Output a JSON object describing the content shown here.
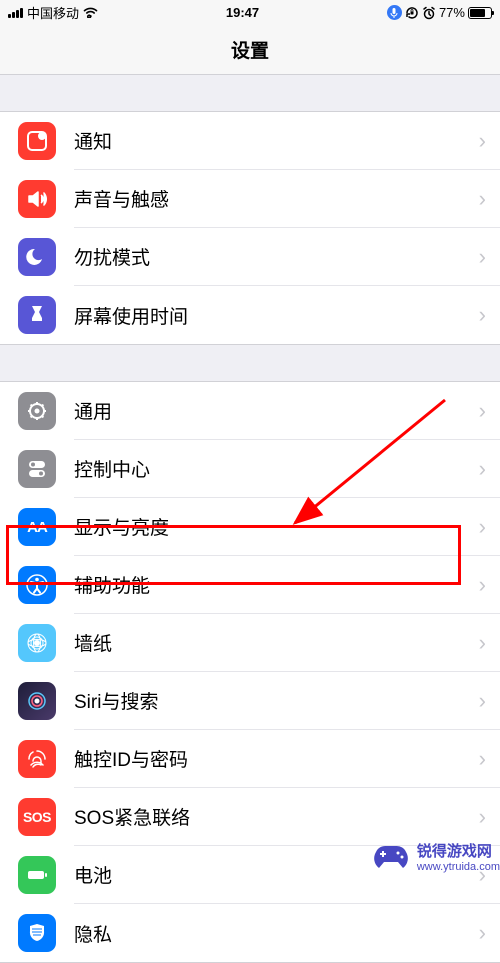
{
  "statusBar": {
    "carrier": "中国移动",
    "time": "19:47",
    "batteryPercent": "77%"
  },
  "header": {
    "title": "设置"
  },
  "groups": [
    {
      "items": [
        {
          "id": "notifications",
          "label": "通知",
          "iconName": "notifications-icon"
        },
        {
          "id": "sounds",
          "label": "声音与触感",
          "iconName": "sounds-icon"
        },
        {
          "id": "dnd",
          "label": "勿扰模式",
          "iconName": "dnd-icon"
        },
        {
          "id": "screentime",
          "label": "屏幕使用时间",
          "iconName": "screentime-icon"
        }
      ]
    },
    {
      "items": [
        {
          "id": "general",
          "label": "通用",
          "iconName": "general-icon"
        },
        {
          "id": "control",
          "label": "控制中心",
          "iconName": "control-center-icon"
        },
        {
          "id": "display",
          "label": "显示与亮度",
          "iconName": "display-icon"
        },
        {
          "id": "accessibility",
          "label": "辅助功能",
          "iconName": "accessibility-icon",
          "highlighted": true
        },
        {
          "id": "wallpaper",
          "label": "墙纸",
          "iconName": "wallpaper-icon"
        },
        {
          "id": "siri",
          "label": "Siri与搜索",
          "iconName": "siri-icon"
        },
        {
          "id": "touchid",
          "label": "触控ID与密码",
          "iconName": "touchid-icon"
        },
        {
          "id": "sos",
          "label": "SOS紧急联络",
          "iconName": "sos-icon"
        },
        {
          "id": "battery",
          "label": "电池",
          "iconName": "battery-icon"
        },
        {
          "id": "privacy",
          "label": "隐私",
          "iconName": "privacy-icon"
        }
      ]
    }
  ],
  "watermark": {
    "brand": "锐得游戏网",
    "url": "www.ytruida.com"
  }
}
